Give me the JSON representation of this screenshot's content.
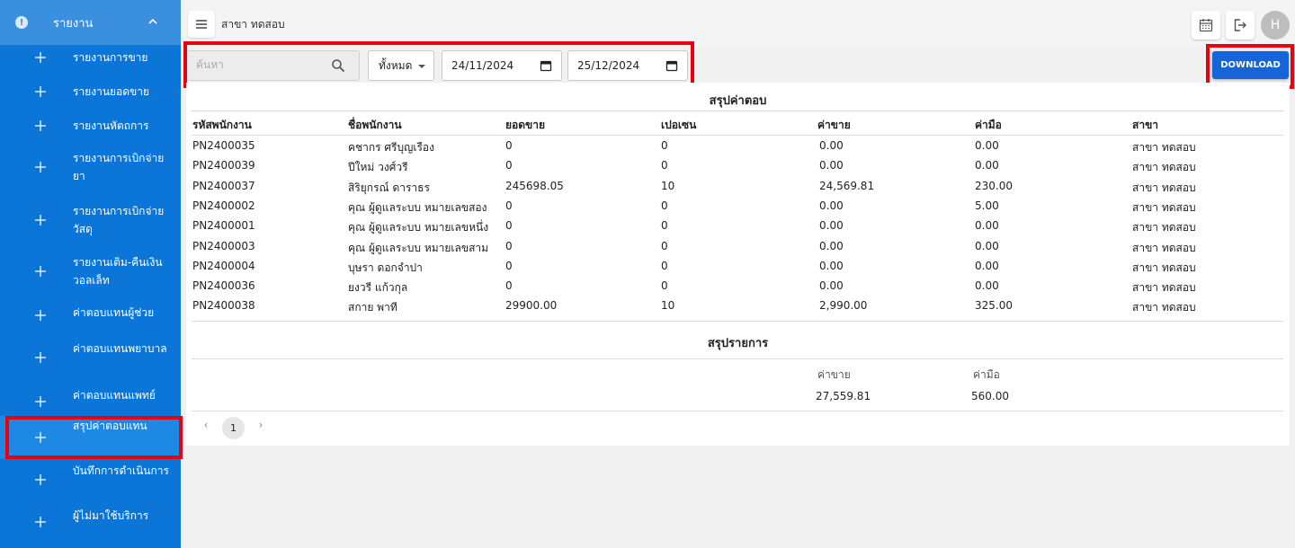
{
  "sidebar": {
    "header_label": "รายงาน",
    "items": [
      {
        "label": "รายงานการขาย"
      },
      {
        "label": "รายงานยอดขาย"
      },
      {
        "label": "รายงานหัตถการ"
      },
      {
        "label": "รายงานการเบิกจ่ายยา"
      },
      {
        "label": "รายงานการเบิกจ่ายวัสดุ"
      },
      {
        "label": "รายงานเติม-คืนเงินวอลเล็ท"
      },
      {
        "label": "ค่าตอบแทนผู้ช่วย"
      },
      {
        "label": "ค่าตอบแทนพยาบาล"
      },
      {
        "label": "ค่าตอบแทนแพทย์"
      },
      {
        "label": "สรุปค่าตอบแทน"
      },
      {
        "label": "บันทึกการดำเนินการ"
      },
      {
        "label": "ผู้ไม่มาใช้บริการ"
      }
    ],
    "active_index": 9
  },
  "topbar": {
    "branch": "สาขา ทดสอบ",
    "avatar_letter": "H"
  },
  "filters": {
    "search_placeholder": "ค้นหา",
    "select_value": "ทั้งหมด",
    "date_from": "24/11/2024",
    "date_to": "25/12/2024",
    "download_label": "DOWNLOAD"
  },
  "table": {
    "title": "สรุปค่าตอบ",
    "headers": [
      "รหัสพนักงาน",
      "ชื่อพนักงาน",
      "ยอดขาย",
      "เปอเซน",
      "ค่าขาย",
      "ค่ามือ",
      "สาขา"
    ],
    "rows": [
      [
        "PN2400035",
        "คชากร ศรีบุญเรือง",
        "0",
        "0",
        "0.00",
        "0.00",
        "สาขา ทดสอบ"
      ],
      [
        "PN2400039",
        "ปีใหม่ วงศ์วรี",
        "0",
        "0",
        "0.00",
        "0.00",
        "สาขา ทดสอบ"
      ],
      [
        "PN2400037",
        "สิริยุกรณ์ ดาราธร",
        "245698.05",
        "10",
        "24,569.81",
        "230.00",
        "สาขา ทดสอบ"
      ],
      [
        "PN2400002",
        "คุณ ผู้ดูแลระบบ หมายเลขสอง",
        "0",
        "0",
        "0.00",
        "5.00",
        "สาขา ทดสอบ"
      ],
      [
        "PN2400001",
        "คุณ ผู้ดูแลระบบ หมายเลขหนึ่ง",
        "0",
        "0",
        "0.00",
        "0.00",
        "สาขา ทดสอบ"
      ],
      [
        "PN2400003",
        "คุณ ผู้ดูแลระบบ หมายเลขสาม",
        "0",
        "0",
        "0.00",
        "0.00",
        "สาขา ทดสอบ"
      ],
      [
        "PN2400004",
        "บุษรา ดอกจำปา",
        "0",
        "0",
        "0.00",
        "0.00",
        "สาขา ทดสอบ"
      ],
      [
        "PN2400036",
        "ยงวรี แก้วกุล",
        "0",
        "0",
        "0.00",
        "0.00",
        "สาขา ทดสอบ"
      ],
      [
        "PN2400038",
        "สกาย พาที",
        "29900.00",
        "10",
        "2,990.00",
        "325.00",
        "สาขา ทดสอบ"
      ]
    ]
  },
  "summary": {
    "title": "สรุปรายการ",
    "sales_label": "ค่าขาย",
    "hand_label": "ค่ามือ",
    "sales_value": "27,559.81",
    "hand_value": "560.00"
  },
  "pagination": {
    "current_page": "1",
    "prev": "‹",
    "next": "›"
  }
}
